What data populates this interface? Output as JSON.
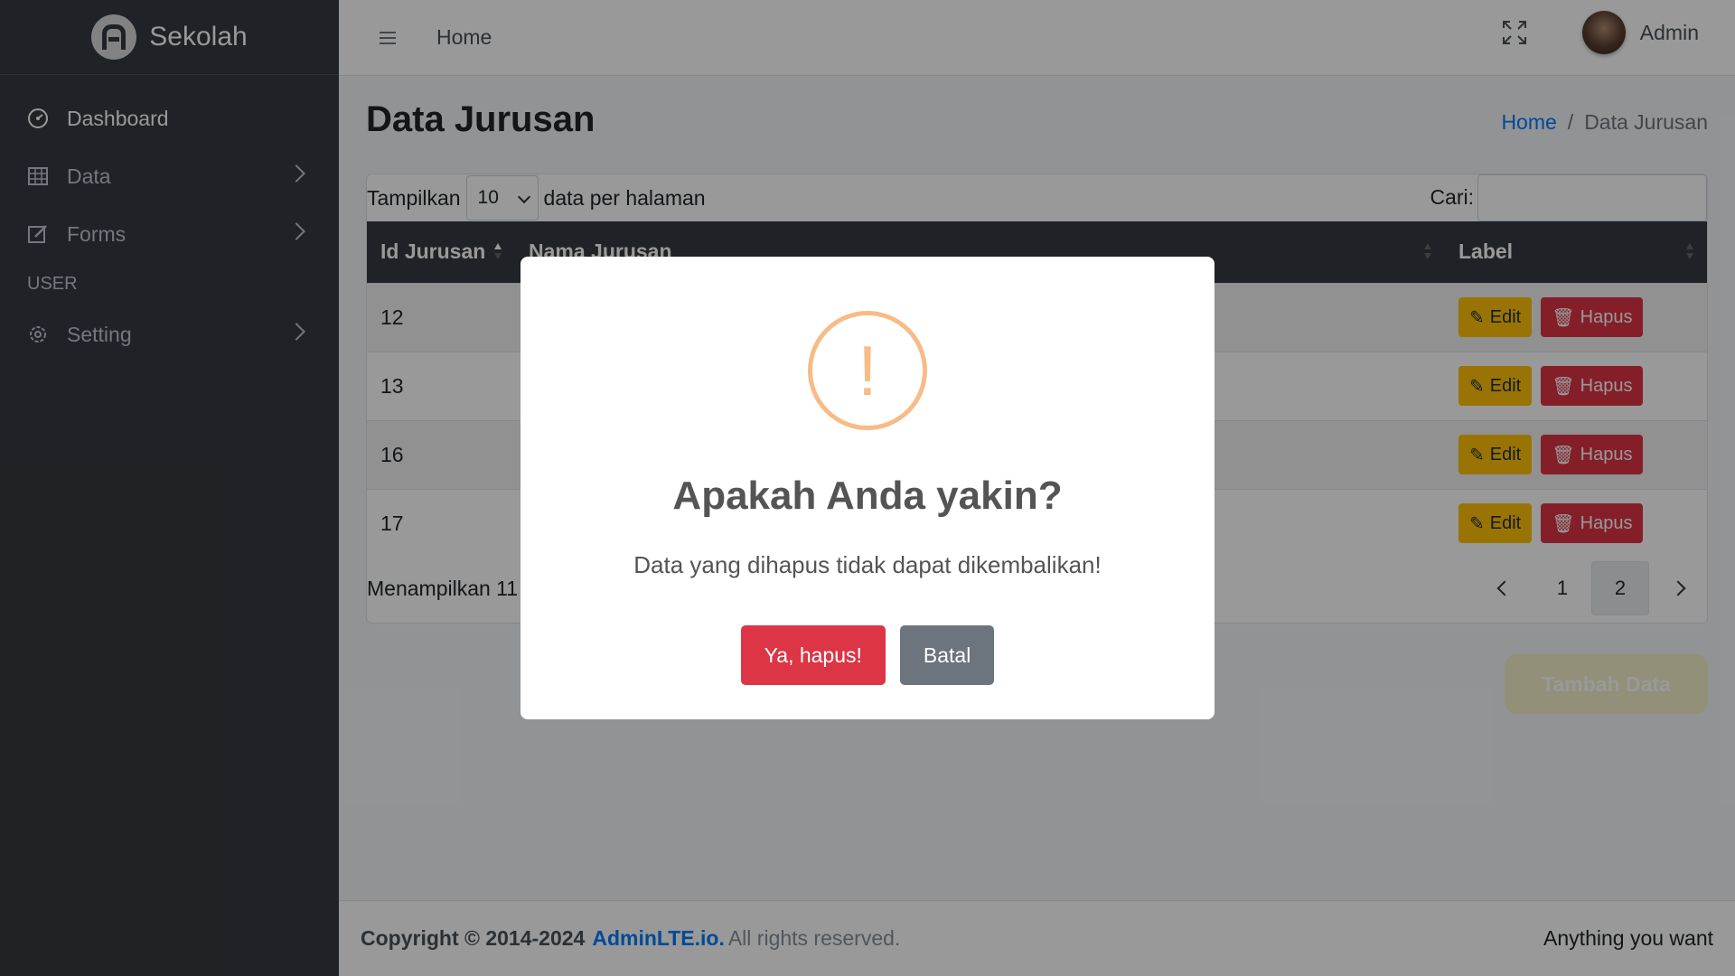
{
  "brand": {
    "name": "Sekolah"
  },
  "sidebar": {
    "items": [
      {
        "label": "Dashboard",
        "icon": "dashboard-icon"
      },
      {
        "label": "Data",
        "icon": "table-icon"
      },
      {
        "label": "Forms",
        "icon": "edit-icon"
      }
    ],
    "header": "USER",
    "setting_label": "Setting"
  },
  "topbar": {
    "home": "Home",
    "user": "Admin"
  },
  "page": {
    "title": "Data Jurusan"
  },
  "breadcrumb": {
    "home": "Home",
    "sep": "/",
    "current": "Data Jurusan"
  },
  "table": {
    "show_label": "Tampilkan",
    "page_size": "10",
    "per_page_label": "data per halaman",
    "search_label": "Cari:",
    "columns": [
      "Id Jurusan",
      "Nama Jurusan",
      "Label"
    ],
    "rows": [
      {
        "id": "12"
      },
      {
        "id": "13"
      },
      {
        "id": "16"
      },
      {
        "id": "17"
      }
    ],
    "edit_label": "Edit",
    "delete_label": "Hapus",
    "info": "Menampilkan 11",
    "pages": [
      "1",
      "2"
    ]
  },
  "add_button": "Tambah Data",
  "footer": {
    "copyright": "Copyright © 2014-2024",
    "link": "AdminLTE.io.",
    "rights": "All rights reserved.",
    "right_text": "Anything you want"
  },
  "modal": {
    "icon": "!",
    "title": "Apakah Anda yakin?",
    "text": "Data yang dihapus tidak dapat dikembalikan!",
    "confirm": "Ya, hapus!",
    "cancel": "Batal",
    "colors": {
      "warning": "#f8bb86",
      "confirm": "#dc3545",
      "cancel": "#6c757d"
    }
  }
}
